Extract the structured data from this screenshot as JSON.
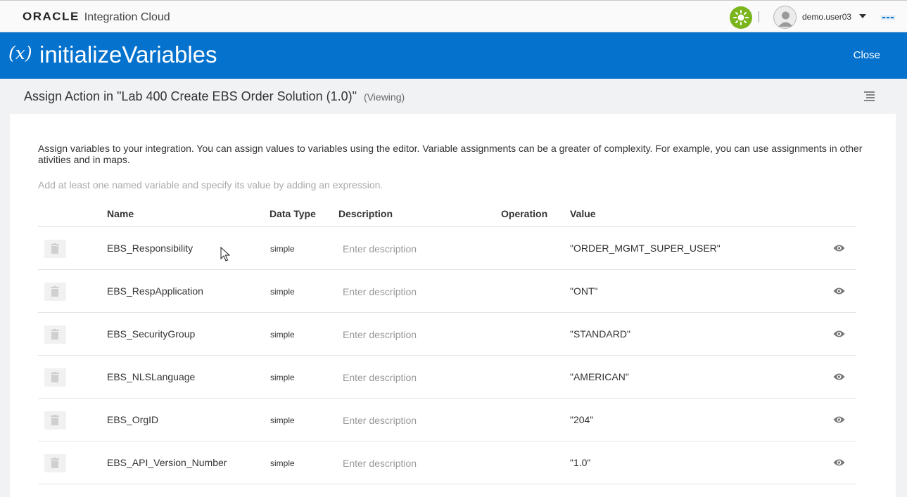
{
  "brand": {
    "company": "ORACLE",
    "product": "Integration Cloud"
  },
  "user": {
    "name": "demo.user03"
  },
  "titlebar": {
    "icon_text": "(x)",
    "title": "initializeVariables",
    "close_label": "Close"
  },
  "subheader": {
    "title": "Assign Action in \"Lab 400 Create EBS Order Solution (1.0)\"",
    "mode": "(Viewing)"
  },
  "main": {
    "description": "Assign variables to your integration. You can assign values to variables using the editor. Variable assignments can be a greater of complexity. For example, you can use assignments in other ativities and in maps.",
    "hint": "Add at least one named variable and specify its value by adding an expression."
  },
  "table": {
    "columns": {
      "name": "Name",
      "data_type": "Data Type",
      "description": "Description",
      "operation": "Operation",
      "value": "Value"
    },
    "rows": [
      {
        "name": "EBS_Responsibility",
        "type": "simple",
        "description_placeholder": "Enter description",
        "value": "\"ORDER_MGMT_SUPER_USER\""
      },
      {
        "name": "EBS_RespApplication",
        "type": "simple",
        "description_placeholder": "Enter description",
        "value": "\"ONT\""
      },
      {
        "name": "EBS_SecurityGroup",
        "type": "simple",
        "description_placeholder": "Enter description",
        "value": "\"STANDARD\""
      },
      {
        "name": "EBS_NLSLanguage",
        "type": "simple",
        "description_placeholder": "Enter description",
        "value": "\"AMERICAN\""
      },
      {
        "name": "EBS_OrgID",
        "type": "simple",
        "description_placeholder": "Enter description",
        "value": "\"204\""
      },
      {
        "name": "EBS_API_Version_Number",
        "type": "simple",
        "description_placeholder": "Enter description",
        "value": "\"1.0\""
      }
    ]
  },
  "colors": {
    "header_blue": "#0572ce",
    "status_green": "#7ab51d"
  },
  "icons": [
    "sun-icon",
    "user-avatar-icon",
    "caret-down-icon",
    "more-menu-icon",
    "variable-icon",
    "list-icon",
    "trash-icon",
    "eye-icon",
    "cursor-pointer-icon"
  ]
}
